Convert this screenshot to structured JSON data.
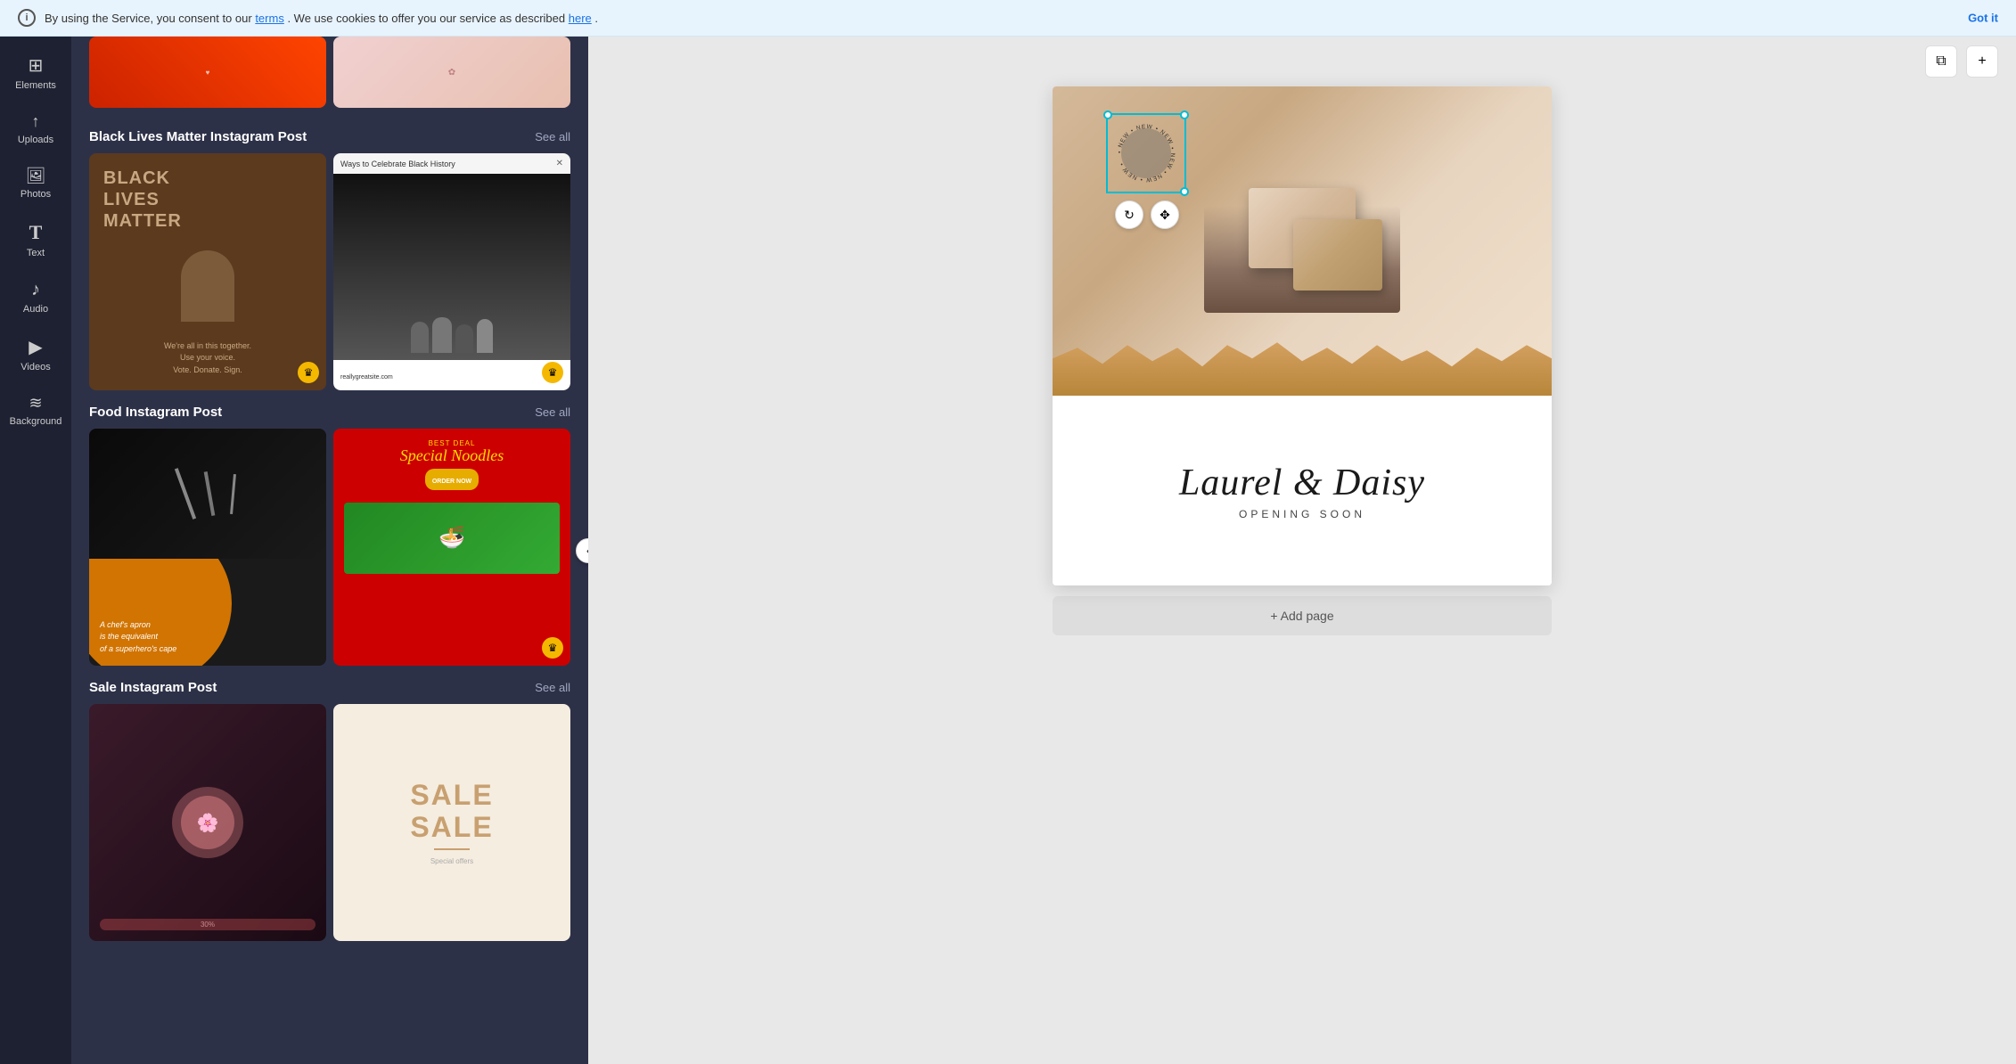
{
  "cookie_banner": {
    "message": "By using the Service, you consent to our ",
    "terms_link": "terms",
    "middle_text": ". We use cookies to offer you our service as described ",
    "here_link": "here",
    "end_text": ".",
    "got_it": "Got it"
  },
  "sidebar": {
    "items": [
      {
        "id": "elements",
        "icon": "⊞",
        "label": "Elements"
      },
      {
        "id": "uploads",
        "icon": "↑",
        "label": "Uploads"
      },
      {
        "id": "photos",
        "icon": "🖼",
        "label": "Photos"
      },
      {
        "id": "text",
        "icon": "T",
        "label": "Text"
      },
      {
        "id": "audio",
        "icon": "♪",
        "label": "Audio"
      },
      {
        "id": "videos",
        "icon": "▶",
        "label": "Videos"
      },
      {
        "id": "background",
        "icon": "≋",
        "label": "Background"
      }
    ]
  },
  "templates_panel": {
    "sections": [
      {
        "id": "black-lives-matter",
        "title": "Black Lives Matter Instagram Post",
        "see_all": "See all",
        "cards": [
          {
            "type": "blm",
            "title": "BLACK\nLIVES\nMATTER",
            "subtitle": "We're all in this together.\nUse your voice.\nVote. Donate. Sign.",
            "premium": true
          },
          {
            "type": "bhm",
            "header": "Ways to Celebrate Black History",
            "premium": true
          }
        ]
      },
      {
        "id": "food",
        "title": "Food Instagram Post",
        "see_all": "See all",
        "cards": [
          {
            "type": "food-orange",
            "quote": "A chef's apron\nis the equivalent\nof a superhero's cape",
            "premium": false
          },
          {
            "type": "food-red",
            "deal": "Best Deal",
            "title": "Special Noodles",
            "premium": true
          }
        ]
      },
      {
        "id": "sale",
        "title": "Sale Instagram Post",
        "see_all": "See all",
        "cards": [
          {
            "type": "sale-pink",
            "premium": false
          },
          {
            "type": "sale-beige",
            "text": "SALE",
            "premium": false
          }
        ]
      }
    ],
    "collapse_icon": "‹"
  },
  "canvas": {
    "toolbar": {
      "duplicate_icon": "⧉",
      "expand_icon": "+"
    },
    "design": {
      "brand_name": "Laurel & Daisy",
      "opening_soon": "OPENING SOON"
    },
    "selected_element": {
      "type": "circular-text",
      "text": "• NEW • NEW • NEW • NEW • NEW • NEW •"
    },
    "add_page_label": "+ Add page"
  }
}
